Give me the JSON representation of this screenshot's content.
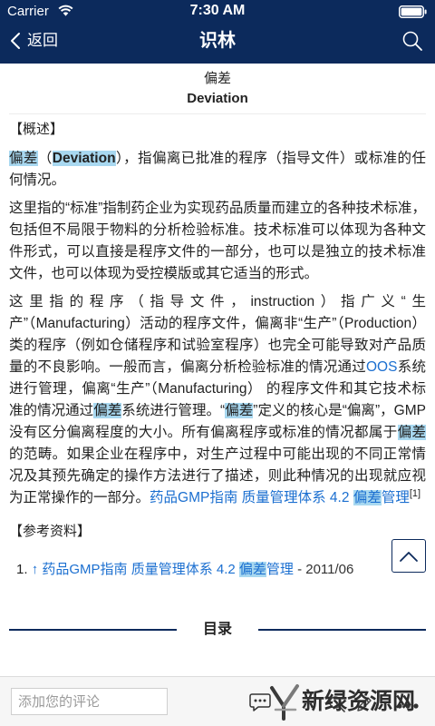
{
  "status_bar": {
    "carrier": "Carrier",
    "time": "7:30 AM",
    "icons": [
      "wifi-icon",
      "battery-icon"
    ]
  },
  "nav": {
    "back_label": "返回",
    "title": "识林",
    "back_icon": "chevron-left-icon",
    "search_icon": "search-icon"
  },
  "article": {
    "title_zh": "偏差",
    "title_en": "Deviation",
    "overview": {
      "heading": "【概述】",
      "paragraphs": [
        [
          "偏差",
          "（",
          "Deviation",
          "），指偏离已批准的程序（指导文件）或标准的任何情况。"
        ],
        [
          "这里指的“标准”指制药企业为实现药品质量而建立的各种技术标准，包括但不局限于物料的分析检验标准。技术标准可以体现为各种文件形式，可以直接是程序文件的一部分，也可以是独立的技术标准文件，也可以体现为受控模版或其它适当的形式。"
        ],
        [
          "这里指的程序（指导文件，instruction）指广义“生产”（Manufacturing）活动的程序文件，偏离非“生产”（Production） 类的程序（例如仓储程序和试验室程序）也完全可能导致对产品质量的不良影响。一般而言，偏离分析检验标准的情况通过",
          "OOS",
          "系统进行管理，偏离“生产”（Manufacturing） 的程序文件和其它技术标准的情况通过",
          "偏差",
          "系统进行管理。“",
          "偏差",
          "”定义的核心是“偏离”，GMP没有区分偏离程度的大小。所有偏离程序或标准的情况都属于",
          "偏差",
          "的范畴。如果企业在程序中，对生产过程中可能出现的不同正常情况及其预先确定的操作方法进行了描述，则此种情况的出现就应视为正常操作的一部分。",
          "药品GMP指南 质量管理体系 4.2 ",
          "偏差",
          "管理",
          "[1]"
        ]
      ]
    },
    "references": {
      "heading": "【参考资料】",
      "items": [
        {
          "number": "1.",
          "arrow": "↑",
          "link": [
            "药品GMP指南 质量管理体系 4.2 ",
            "偏差",
            "管理"
          ],
          "date": " - 2011/06"
        }
      ]
    }
  },
  "scroll_top_icon": "chevron-up-icon",
  "toc": {
    "label": "目录"
  },
  "comment_box": {
    "placeholder": "添加您的评论"
  },
  "toolbar": {
    "icons": [
      "comment-icon",
      "search-icon",
      "edit-icon",
      "more-icon"
    ]
  },
  "watermark": {
    "text": "新绿资源网"
  },
  "colors": {
    "header_bg": "#0c2a5c",
    "highlight": "#a8d8f0",
    "link": "#1b6fd0",
    "toolbar_bg": "#f6f6f6"
  }
}
